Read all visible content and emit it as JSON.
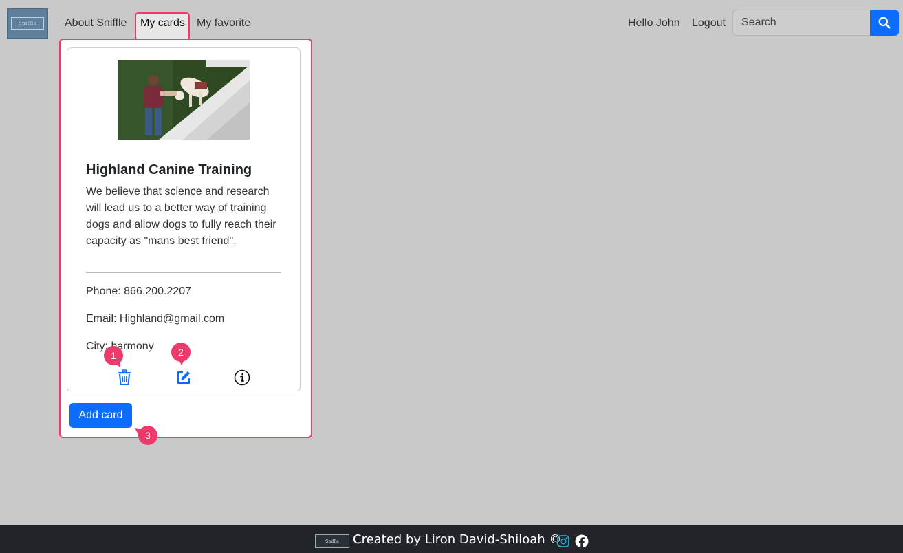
{
  "navbar": {
    "logo_text": "Sniffle",
    "links": {
      "about": "About Sniffle",
      "my_cards": "My cards",
      "my_favorite": "My favorite"
    },
    "greeting": "Hello John",
    "logout": "Logout",
    "search": {
      "placeholder": "Search",
      "button_icon": "search-icon"
    }
  },
  "card": {
    "title": "Highland Canine Training",
    "description": "We believe that science and research will lead us to a better way of training dogs and allow dogs to fully reach their capacity as \"mans best friend\".",
    "phone": "Phone: 866.200.2207",
    "email": "Email: Highland@gmail.com",
    "city": "City: harmony",
    "actions": [
      "trash-icon",
      "edit-icon",
      "info-icon"
    ]
  },
  "add_card_label": "Add card",
  "markers": [
    "1",
    "2",
    "3"
  ],
  "footer": {
    "logo_text": "Sniffle",
    "text": "Created by Liron David-Shiloah ©",
    "social": [
      "instagram-icon",
      "facebook-icon"
    ]
  },
  "colors": {
    "accent": "#0d6efd",
    "highlight": "#ee3a6a",
    "footer_bg": "#212529",
    "page_bg": "#c9c9c9"
  }
}
